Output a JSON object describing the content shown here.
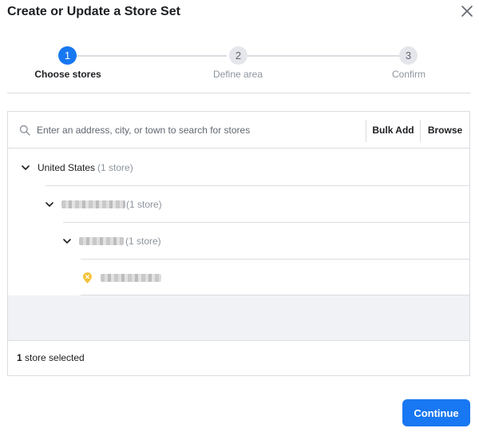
{
  "dialog": {
    "title": "Create or Update a Store Set"
  },
  "steps": [
    {
      "number": "1",
      "label": "Choose stores",
      "state": "active"
    },
    {
      "number": "2",
      "label": "Define area",
      "state": "inactive"
    },
    {
      "number": "3",
      "label": "Confirm",
      "state": "inactive"
    }
  ],
  "search": {
    "placeholder": "Enter an address, city, or town to search for stores",
    "bulk_add_label": "Bulk Add",
    "browse_label": "Browse"
  },
  "tree": {
    "country": {
      "name": "United States",
      "count": "(1 store)"
    },
    "region": {
      "count": "(1 store)"
    },
    "city": {
      "count": "(1 store)"
    }
  },
  "footer": {
    "selected_count": "1",
    "selected_suffix": " store selected"
  },
  "actions": {
    "continue_label": "Continue"
  },
  "colors": {
    "accent": "#1877f2",
    "pin": "#f5c33b"
  }
}
